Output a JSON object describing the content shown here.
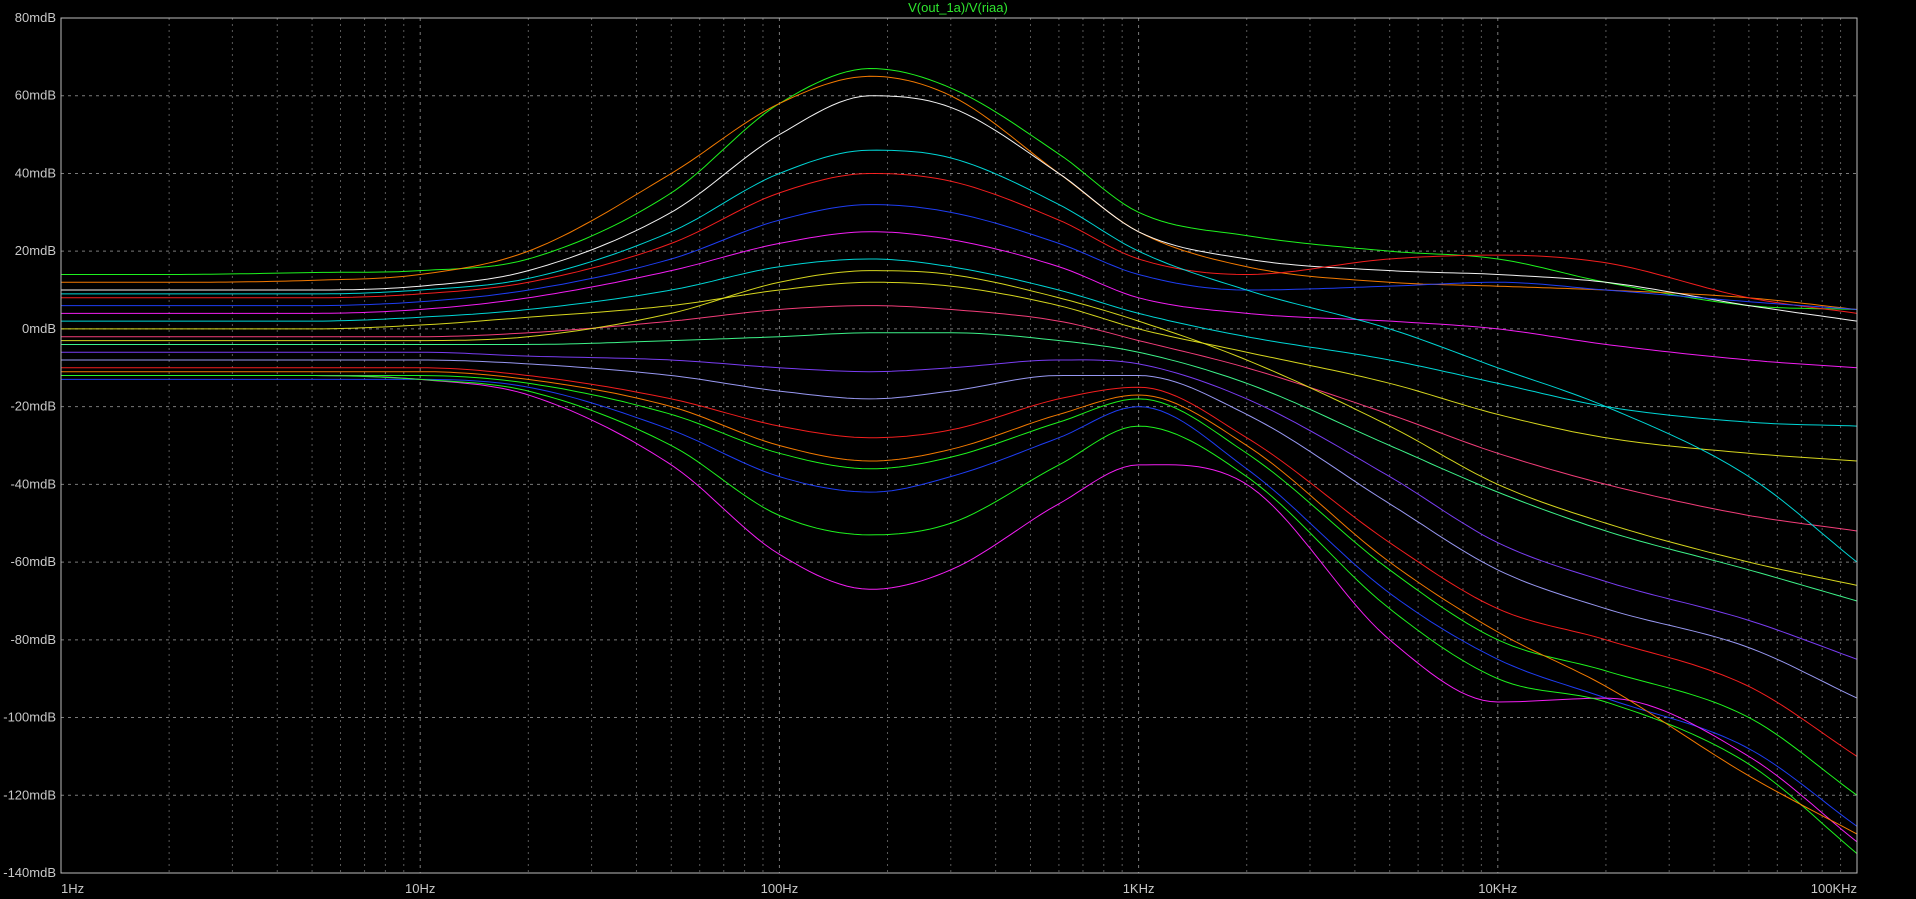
{
  "chart_data": {
    "type": "line",
    "title": "V(out_1a)/V(riaa)",
    "x_scale": "log",
    "xlim": [
      1,
      100000
    ],
    "ylim": [
      -140,
      80
    ],
    "x_ticks": [
      {
        "value": 1,
        "label": "1Hz"
      },
      {
        "value": 10,
        "label": "10Hz"
      },
      {
        "value": 100,
        "label": "100Hz"
      },
      {
        "value": 1000,
        "label": "1KHz"
      },
      {
        "value": 10000,
        "label": "10KHz"
      },
      {
        "value": 100000,
        "label": "100KHz"
      }
    ],
    "y_ticks": [
      {
        "value": 80,
        "label": "80mdB"
      },
      {
        "value": 60,
        "label": "60mdB"
      },
      {
        "value": 40,
        "label": "40mdB"
      },
      {
        "value": 20,
        "label": "20mdB"
      },
      {
        "value": 0,
        "label": "0mdB"
      },
      {
        "value": -20,
        "label": "-20mdB"
      },
      {
        "value": -40,
        "label": "-40mdB"
      },
      {
        "value": -60,
        "label": "-60mdB"
      },
      {
        "value": -80,
        "label": "-80mdB"
      },
      {
        "value": -100,
        "label": "-100mdB"
      },
      {
        "value": -120,
        "label": "-120mdB"
      },
      {
        "value": -140,
        "label": "-140mdB"
      }
    ],
    "grid": true,
    "colors": [
      "#ff2020",
      "#20ff20",
      "#2040ff",
      "#ff20ff",
      "#00e0e0",
      "#e0e020",
      "#ff8000",
      "#ffffff",
      "#ff4080",
      "#40ff90",
      "#8040ff",
      "#a0a0ff"
    ],
    "x": [
      1,
      2,
      5,
      10,
      20,
      50,
      100,
      180,
      300,
      600,
      1000,
      2000,
      5000,
      10000,
      20000,
      50000,
      100000
    ],
    "series": [
      {
        "color_index": 1,
        "values": [
          14,
          14,
          14.5,
          15,
          18,
          35,
          58,
          67,
          62,
          45,
          30,
          24,
          20,
          18,
          12,
          6,
          5
        ]
      },
      {
        "color_index": 6,
        "values": [
          12,
          12,
          12.5,
          14,
          20,
          40,
          58,
          65,
          60,
          40,
          25,
          16,
          12,
          11,
          10,
          8,
          5
        ]
      },
      {
        "color_index": 7,
        "values": [
          10,
          10,
          10,
          11,
          15,
          30,
          50,
          60,
          57,
          40,
          25,
          18,
          15,
          14,
          12,
          6,
          2
        ]
      },
      {
        "color_index": 0,
        "values": [
          8,
          8,
          8,
          9,
          12,
          22,
          35,
          40,
          38,
          28,
          18,
          14,
          18,
          19,
          17,
          8,
          4
        ]
      },
      {
        "color_index": 2,
        "values": [
          6,
          6,
          6,
          7,
          10,
          18,
          28,
          32,
          30,
          22,
          14,
          10,
          11,
          12,
          10,
          7,
          5
        ]
      },
      {
        "color_index": 3,
        "values": [
          4,
          4,
          4,
          5,
          8,
          15,
          22,
          25,
          23,
          16,
          8,
          4,
          2,
          0,
          -4,
          -8,
          -10
        ]
      },
      {
        "color_index": 4,
        "values": [
          2,
          2,
          2,
          3,
          5,
          10,
          16,
          18,
          16,
          10,
          4,
          -2,
          -8,
          -14,
          -20,
          -24,
          -25
        ]
      },
      {
        "color_index": 5,
        "values": [
          0,
          0,
          0,
          1,
          3,
          6,
          10,
          12,
          11,
          6,
          0,
          -6,
          -14,
          -22,
          -28,
          -32,
          -34
        ]
      },
      {
        "color_index": 8,
        "values": [
          -2,
          -2,
          -2,
          -2,
          -1,
          2,
          5,
          6,
          5,
          2,
          -3,
          -10,
          -22,
          -32,
          -40,
          -48,
          -52
        ]
      },
      {
        "color_index": 9,
        "values": [
          -4,
          -4,
          -4,
          -4,
          -4,
          -3,
          -2,
          -1,
          -1,
          -3,
          -6,
          -14,
          -30,
          -42,
          -52,
          -62,
          -70
        ]
      },
      {
        "color_index": 10,
        "values": [
          -6,
          -6,
          -6,
          -6,
          -7,
          -8,
          -10,
          -11,
          -10,
          -8,
          -9,
          -18,
          -38,
          -55,
          -65,
          -75,
          -85
        ]
      },
      {
        "color_index": 11,
        "values": [
          -8,
          -8,
          -8,
          -8,
          -9,
          -12,
          -16,
          -18,
          -16,
          -12,
          -12,
          -22,
          -45,
          -62,
          -72,
          -82,
          -95
        ]
      },
      {
        "color_index": 0,
        "values": [
          -10,
          -10,
          -10,
          -10,
          -12,
          -18,
          -25,
          -28,
          -26,
          -18,
          -15,
          -28,
          -55,
          -72,
          -80,
          -92,
          -110
        ]
      },
      {
        "color_index": 1,
        "values": [
          -12,
          -12,
          -12,
          -12,
          -14,
          -22,
          -32,
          -36,
          -33,
          -24,
          -18,
          -32,
          -62,
          -80,
          -88,
          -100,
          -120
        ]
      },
      {
        "color_index": 2,
        "values": [
          -13,
          -13,
          -13,
          -13,
          -15,
          -26,
          -38,
          -42,
          -38,
          -28,
          -20,
          -36,
          -68,
          -85,
          -95,
          -108,
          -128
        ]
      },
      {
        "color_index": 3,
        "values": [
          -12,
          -12,
          -12,
          -13,
          -17,
          -35,
          -58,
          -67,
          -62,
          -45,
          -35,
          -40,
          -80,
          -96,
          -95,
          -110,
          -132
        ]
      },
      {
        "color_index": 1,
        "values": [
          -12,
          -12,
          -12,
          -13,
          -16,
          -30,
          -48,
          -53,
          -50,
          -35,
          -25,
          -38,
          -72,
          -90,
          -96,
          -112,
          -135
        ]
      },
      {
        "color_index": 6,
        "values": [
          -11,
          -11,
          -11,
          -11,
          -13,
          -20,
          -30,
          -34,
          -31,
          -22,
          -17,
          -30,
          -60,
          -78,
          -92,
          -115,
          -130
        ]
      },
      {
        "color_index": 4,
        "values": [
          9,
          9,
          9,
          10,
          13,
          25,
          40,
          46,
          44,
          32,
          20,
          10,
          0,
          -10,
          -20,
          -38,
          -60
        ]
      },
      {
        "color_index": 5,
        "values": [
          -3,
          -3,
          -3,
          -3,
          -2,
          4,
          12,
          15,
          14,
          8,
          2,
          -8,
          -25,
          -40,
          -50,
          -60,
          -66
        ]
      }
    ]
  }
}
